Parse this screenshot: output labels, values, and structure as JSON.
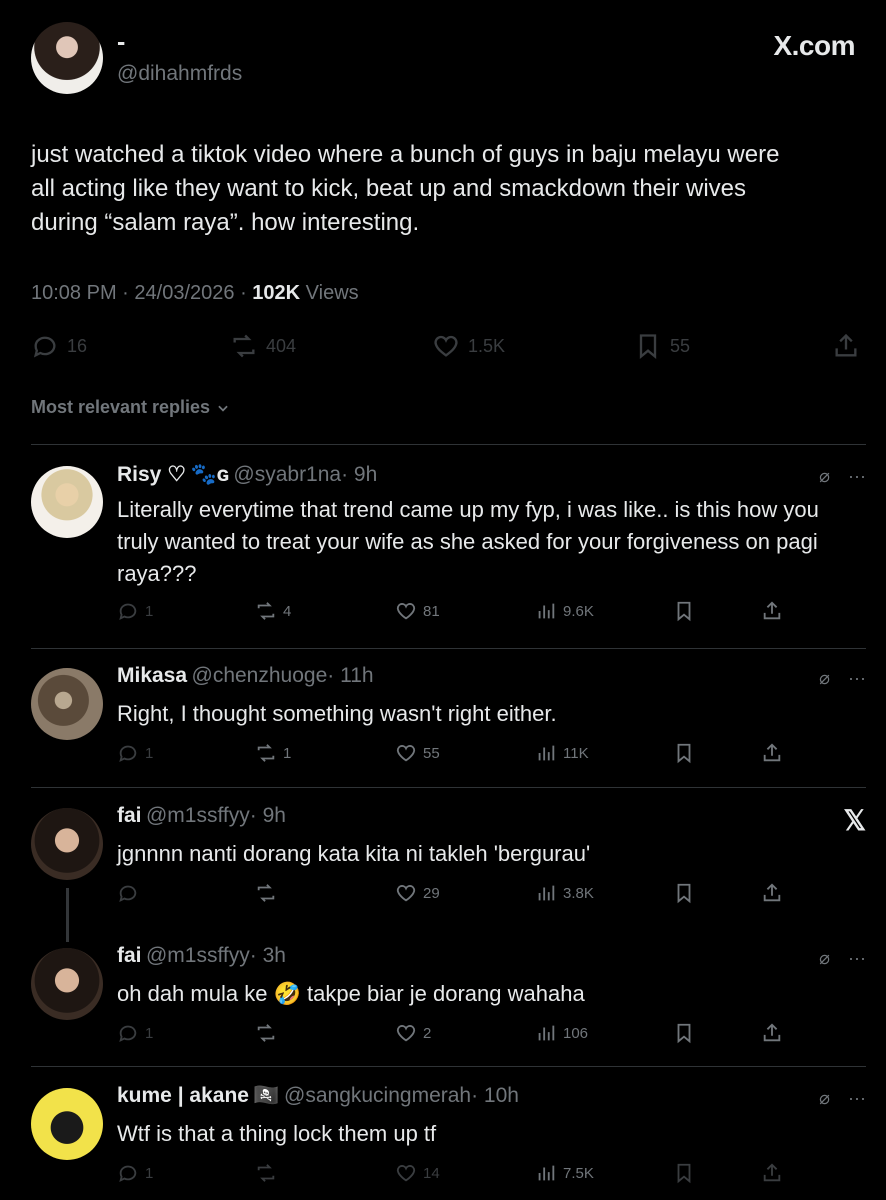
{
  "header": {
    "display_name": "-",
    "handle": "@dihahmfrds",
    "site_label": "X.com"
  },
  "post": {
    "text_line1": "just watched a tiktok video where a bunch of guys in baju melayu were",
    "text_line2": "all acting like they want to kick, beat up and smackdown their wives",
    "text_line3": "during “salam raya”. how interesting.",
    "time": "10:08 PM",
    "date": "24/03/2026",
    "views_count": "102K",
    "views_label": "Views",
    "actions": {
      "replies": "16",
      "reposts": "404",
      "likes": "1.5K",
      "bookmarks": "55"
    }
  },
  "replies_filter": "Most relevant replies",
  "replies": [
    {
      "name": "Risy ♡",
      "name_suffix": "🐾ɢ",
      "handle": "@syabr1na",
      "time": "· 9h",
      "lines": [
        "Literally everytime that trend came up my fyp, i was like.. is this how you",
        "truly wanted to treat your wife as she asked for your forgiveness on pagi",
        "raya???"
      ],
      "replies": "1",
      "reposts": "4",
      "likes": "81",
      "views": "9.6K"
    },
    {
      "name": "Mikasa",
      "handle": "@chenzhuoge",
      "time": "· 11h",
      "lines": [
        "Right, I thought something wasn't right either."
      ],
      "replies": "1",
      "reposts": "1",
      "likes": "55",
      "views": "11K"
    },
    {
      "name": "fai",
      "handle": "@m1ssffyy",
      "time": "· 9h",
      "lines": [
        "jgnnnn nanti dorang kata kita ni takleh 'bergurau'"
      ],
      "replies": "",
      "reposts": "",
      "likes": "29",
      "views": "3.8K"
    },
    {
      "name": "fai",
      "handle": "@m1ssffyy",
      "time": "· 3h",
      "lines": [
        "oh dah mula ke 🤣 takpe biar je dorang wahaha"
      ],
      "replies": "1",
      "reposts": "",
      "likes": "2",
      "views": "106"
    },
    {
      "name": "kume | akane",
      "name_suffix": "🏴‍☠️",
      "handle": "@sangkucingmerah",
      "time": "· 10h",
      "lines": [
        "Wtf is that a thing lock them up tf"
      ],
      "replies": "1",
      "reposts": "",
      "likes": "14",
      "views": "7.5K"
    }
  ],
  "colors": {
    "background": "#000000",
    "text": "#e7e9ea",
    "muted": "#71767b",
    "divider": "#2f3336"
  },
  "icons": [
    "reply-icon",
    "repost-icon",
    "like-icon",
    "bookmark-icon",
    "share-icon",
    "views-icon",
    "grok-icon",
    "more-icon",
    "x-logo-icon",
    "chevron-down-icon"
  ]
}
